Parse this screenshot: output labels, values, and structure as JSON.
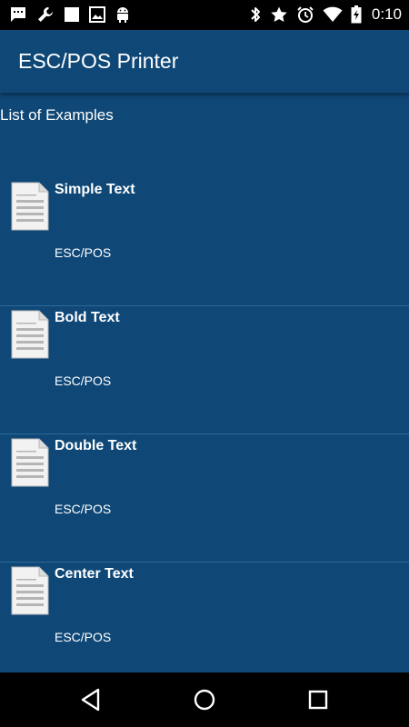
{
  "status_bar": {
    "time": "0:10",
    "left_icons": [
      "message-icon",
      "wrench-icon",
      "square-icon",
      "image-icon",
      "android-icon"
    ],
    "right_icons": [
      "bluetooth-icon",
      "star-icon",
      "alarm-icon",
      "wifi-icon",
      "battery-icon"
    ]
  },
  "app_bar": {
    "title": "ESC/POS Printer"
  },
  "content": {
    "header": "List of Examples",
    "items": [
      {
        "title": "Simple Text",
        "subtitle": "ESC/POS",
        "icon": "document-icon"
      },
      {
        "title": "Bold Text",
        "subtitle": "ESC/POS",
        "icon": "document-icon"
      },
      {
        "title": "Double Text",
        "subtitle": "ESC/POS",
        "icon": "document-icon"
      },
      {
        "title": "Center Text",
        "subtitle": "ESC/POS",
        "icon": "document-icon"
      }
    ]
  },
  "nav_bar": {
    "buttons": [
      "back-icon",
      "home-icon",
      "recents-icon"
    ]
  },
  "colors": {
    "background": "#0f4877",
    "status_bar": "#000000",
    "nav_bar": "#000000",
    "divider": "#2e6896",
    "text": "#ffffff"
  }
}
